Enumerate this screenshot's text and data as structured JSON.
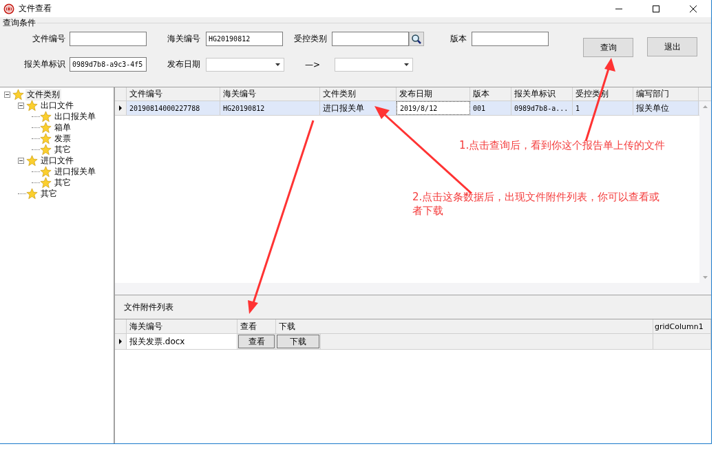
{
  "window": {
    "title": "文件查看"
  },
  "query": {
    "title": "查询条件",
    "file_no": {
      "label": "文件编号"
    },
    "customs_no": {
      "label": "海关编号",
      "value": "HG20190812"
    },
    "control_type": {
      "label": "受控类别"
    },
    "version": {
      "label": "版本"
    },
    "declaration_id": {
      "label": "报关单标识",
      "value": "0989d7b8-a9c3-4f5"
    },
    "publish_date": {
      "label": "发布日期"
    },
    "range_arrow": "—>",
    "buttons": [
      "查询",
      "退出"
    ]
  },
  "tree": [
    {
      "label": "文件类别",
      "selected": true,
      "expanded": true,
      "children": [
        {
          "label": "出口文件",
          "selected": false,
          "expanded": true,
          "children": [
            {
              "label": "出口报关单",
              "selected": false
            },
            {
              "label": "箱单",
              "selected": false
            },
            {
              "label": "发票",
              "selected": false
            },
            {
              "label": "其它",
              "selected": false
            }
          ]
        },
        {
          "label": "进口文件",
          "selected": false,
          "expanded": true,
          "children": [
            {
              "label": "进口报关单",
              "selected": false
            },
            {
              "label": "其它",
              "selected": false
            }
          ]
        },
        {
          "label": "其它",
          "selected": false
        }
      ]
    }
  ],
  "grid": {
    "columns": [
      "文件编号",
      "海关编号",
      "文件类别",
      "发布日期",
      "版本",
      "报关单标识",
      "受控类别",
      "编写部门"
    ],
    "rows": [
      {
        "selected": true,
        "cells": [
          "20190814000227788",
          "HG20190812",
          "进口报关单",
          "2019/8/12",
          "001",
          "0989d7b8-a...",
          "1",
          "报关单位"
        ]
      }
    ]
  },
  "attachments": {
    "title": "文件附件列表",
    "columns": [
      "海关编号",
      "查看",
      "下载",
      "gridColumn1"
    ],
    "rows": [
      {
        "file": "报关发票.docx",
        "view": "查看",
        "download": "下载"
      }
    ]
  },
  "annotations": [
    "1.点击查询后，看到你这个报告单上传的文件",
    "2.点击这条数据后，出现文件附件列表，你可以查看或者下载"
  ]
}
